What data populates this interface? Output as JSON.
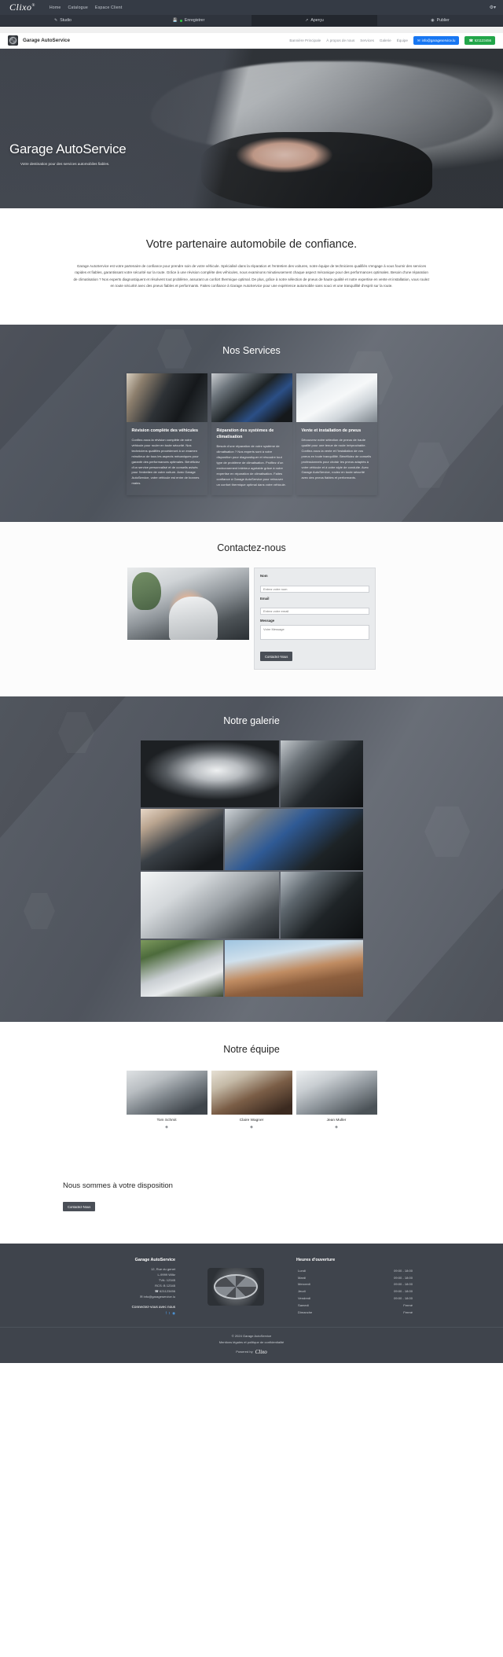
{
  "builder": {
    "logo": "Clixo",
    "logo_sup": "®",
    "nav": [
      {
        "label": "Home"
      },
      {
        "label": "Catalogue"
      },
      {
        "label": "Espace Client"
      }
    ],
    "gear_icon": "gear-icon",
    "tabs": [
      {
        "label": "Studio",
        "icon": "pencil-icon",
        "active": false
      },
      {
        "label": "Enregistrer",
        "icon": "save-icon",
        "active": false,
        "status_dot": true
      },
      {
        "label": "Aperçu",
        "icon": "external-link-icon",
        "active": true
      },
      {
        "label": "Publier",
        "icon": "globe-icon",
        "active": false
      }
    ]
  },
  "site_header": {
    "brand": "Garage AutoService",
    "logo_icon": "gear-wheel-logo",
    "nav": [
      {
        "label": "Bannière Principale"
      },
      {
        "label": "À propos de nous"
      },
      {
        "label": "Services"
      },
      {
        "label": "Galerie"
      },
      {
        "label": "Équipe"
      }
    ],
    "email_button": {
      "label": "info@garageservice.lu",
      "icon": "mail-icon",
      "color": "#1877f2"
    },
    "phone_button": {
      "label": "621123456",
      "icon": "phone-icon",
      "color": "#22a64a"
    }
  },
  "hero": {
    "title": "Garage AutoService",
    "subtitle": "Votre destination pour des services automobiles fiables.",
    "image_alt": "white-sports-car-and-hand-holding-key-fob"
  },
  "recaptcha": {
    "icon": "recaptcha-badge-icon"
  },
  "about": {
    "heading": "Votre partenaire automobile de confiance.",
    "body": "Garage AutoService est votre partenaire de confiance pour prendre soin de votre véhicule. Spécialisé dans la réparation et l'entretien des voitures, notre équipe de techniciens qualifiés s'engage à vous fournir des services rapides et fiables, garantissant votre sécurité sur la route. Grâce à une révision complète des véhicules, nous examinons minutieusement chaque aspect mécanique pour des performances optimales. Besoin d'une réparation de climatisation ? Nos experts diagnostiquent et résolvent tout problème, assurant un confort thermique optimal. De plus, grâce à notre sélection de pneus de haute qualité et notre expertise en vente et installation, vous roulez en toute sécurité avec des pneus fiables et performants. Faites confiance à Garage AutoService pour une expérience automobile sans souci et une tranquillité d'esprit sur la route."
  },
  "services": {
    "heading": "Nos Services",
    "cards": [
      {
        "image": "engine-bay-closeup",
        "title": "Révision complète des véhicules",
        "text": "Confiez-nous la révision complète de votre véhicule pour rouler en toute sécurité. Nos techniciens qualifiés procéderont à un examen minutieux de tous les aspects mécaniques pour garantir des performances optimales. Bénéficiez d'un service personnalisé et de conseils avisés pour l'entretien de votre voiture. Avec Garage AutoService, votre véhicule est entre de bonnes mains."
      },
      {
        "image": "mechanic-working-on-engine",
        "title": "Réparation des systèmes de climatisation",
        "text": "Besoin d'une réparation de votre système de climatisation ? Nos experts sont à votre disposition pour diagnostiquer et résoudre tout type de problème de climatisation. Profitez d'un environnement intérieur agréable grâce à notre expertise en réparation de climatisation. Faites confiance à Garage AutoService pour retrouver un confort thermique optimal dans votre véhicule."
      },
      {
        "image": "white-car-tires",
        "title": "Vente et installation de pneus",
        "text": "Découvrez notre sélection de pneus de haute qualité pour une tenue de route irréprochable. Confiez-nous la vente et l'installation de vos pneus en toute tranquillité. Bénéficiez de conseils professionnels pour choisir les pneus adaptés à votre véhicule et à votre style de conduite. Avec Garage AutoService, roulez en toute sécurité avec des pneus fiables et performants."
      }
    ]
  },
  "contact": {
    "heading": "Contactez-nous",
    "image_alt": "man-with-headset-in-office",
    "fields": {
      "name_label": "Nom",
      "name_placeholder": "Entrez votre nom",
      "email_label": "Email",
      "email_placeholder": "Entrez votre email",
      "message_label": "Message",
      "message_placeholder": "Votre Message"
    },
    "submit_label": "Contactez-Nous"
  },
  "gallery": {
    "heading": "Notre galerie",
    "items": [
      {
        "alt": "white-car-with-key-fob"
      },
      {
        "alt": "engine-bay-detail"
      },
      {
        "alt": "hand-on-tire"
      },
      {
        "alt": "mechanic-engine-tools"
      },
      {
        "alt": "white-car-wheel-closeup"
      },
      {
        "alt": "engine-compartment"
      },
      {
        "alt": "white-sports-car-outdoors"
      },
      {
        "alt": "white-suv-desert-landscape"
      }
    ]
  },
  "team": {
    "heading": "Notre équipe",
    "members": [
      {
        "name": "Tom Schmit",
        "photo_alt": "man-with-glasses-portrait",
        "icon": "social-icon"
      },
      {
        "name": "Claire Wagner",
        "photo_alt": "smiling-woman-portrait",
        "icon": "social-icon"
      },
      {
        "name": "Jean Muller",
        "photo_alt": "man-portrait",
        "icon": "social-icon"
      }
    ]
  },
  "cta": {
    "heading": "Nous sommes à votre disposition",
    "button_label": "Contactez-Nous"
  },
  "footer": {
    "company": "Garage AutoService",
    "address_lines": [
      "12, Rue du genet",
      "L-9999 Wiltz"
    ],
    "tva": "TVA: 12345",
    "rcs": "RCS: B 12345",
    "phone": "621123456",
    "phone_icon": "phone-icon",
    "email": "info@garageservice.lu",
    "email_icon": "mail-icon",
    "connect_title": "Connectez-vous avec nous",
    "socials": [
      {
        "name": "facebook-icon",
        "glyph": "f"
      },
      {
        "name": "twitter-icon",
        "glyph": "t"
      },
      {
        "name": "instagram-icon",
        "glyph": "◉"
      }
    ],
    "logo_alt": "gear-wheel-logo",
    "hours_title": "Heures d'ouverture",
    "hours": [
      {
        "day": "Lundi",
        "time": "09:00 - 18:00"
      },
      {
        "day": "Mardi",
        "time": "09:00 - 18:00"
      },
      {
        "day": "Mercredi",
        "time": "09:00 - 18:00"
      },
      {
        "day": "Jeudi",
        "time": "09:00 - 18:00"
      },
      {
        "day": "Vendredi",
        "time": "09:00 - 18:00"
      },
      {
        "day": "Samedi",
        "time": "Fermé"
      },
      {
        "day": "Dimanche",
        "time": "Fermé"
      }
    ],
    "copyright": "© 2024 Garage AutoService",
    "legal": "Mentions légales et politique de confidentialité",
    "powered_by": "Powered by",
    "powered_logo": "Clixo"
  }
}
